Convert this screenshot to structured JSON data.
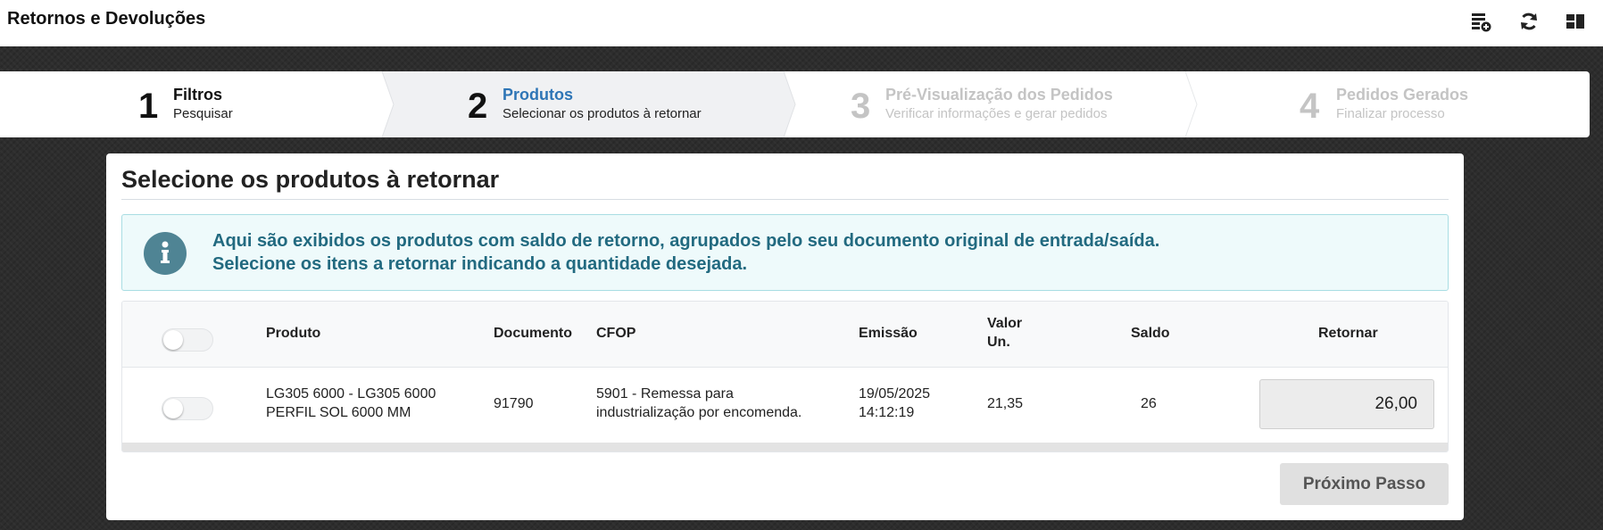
{
  "header": {
    "title": "Retornos e Devoluções",
    "icons": [
      "list-add-icon",
      "refresh-icon",
      "layout-icon"
    ]
  },
  "stepper": {
    "steps": [
      {
        "number": "1",
        "label": "Filtros",
        "sub": "Pesquisar",
        "state": "done"
      },
      {
        "number": "2",
        "label": "Produtos",
        "sub": "Selecionar os produtos à retornar",
        "state": "active"
      },
      {
        "number": "3",
        "label": "Pré-Visualização dos Pedidos",
        "sub": "Verificar informações e gerar pedidos",
        "state": "disabled"
      },
      {
        "number": "4",
        "label": "Pedidos Gerados",
        "sub": "Finalizar processo",
        "state": "disabled"
      }
    ]
  },
  "main": {
    "heading": "Selecione os produtos à retornar",
    "info": {
      "line1": "Aqui são exibidos os produtos com saldo de retorno, agrupados pelo seu documento original de entrada/saída.",
      "line2": "Selecione os itens a retornar indicando a quantidade desejada."
    },
    "table": {
      "columns": {
        "produto": "Produto",
        "documento": "Documento",
        "cfop": "CFOP",
        "emissao": "Emissão",
        "valor_un_1": "Valor",
        "valor_un_2": "Un.",
        "saldo": "Saldo",
        "retornar": "Retornar"
      },
      "rows": [
        {
          "produto_1": "LG305 6000 - LG305 6000",
          "produto_2": "PERFIL SOL 6000 MM",
          "documento": "91790",
          "cfop_1": "5901 - Remessa para",
          "cfop_2": "industrialização por encomenda.",
          "emissao_1": "19/05/2025",
          "emissao_2": "14:12:19",
          "valor_un": "21,35",
          "saldo": "26",
          "retornar": "26,00"
        }
      ]
    },
    "next_button": "Próximo Passo"
  },
  "colors": {
    "accent": "#2e75b6",
    "info_text": "#226a80",
    "info_bg": "#eefafb",
    "info_icon": "#4f8494"
  }
}
